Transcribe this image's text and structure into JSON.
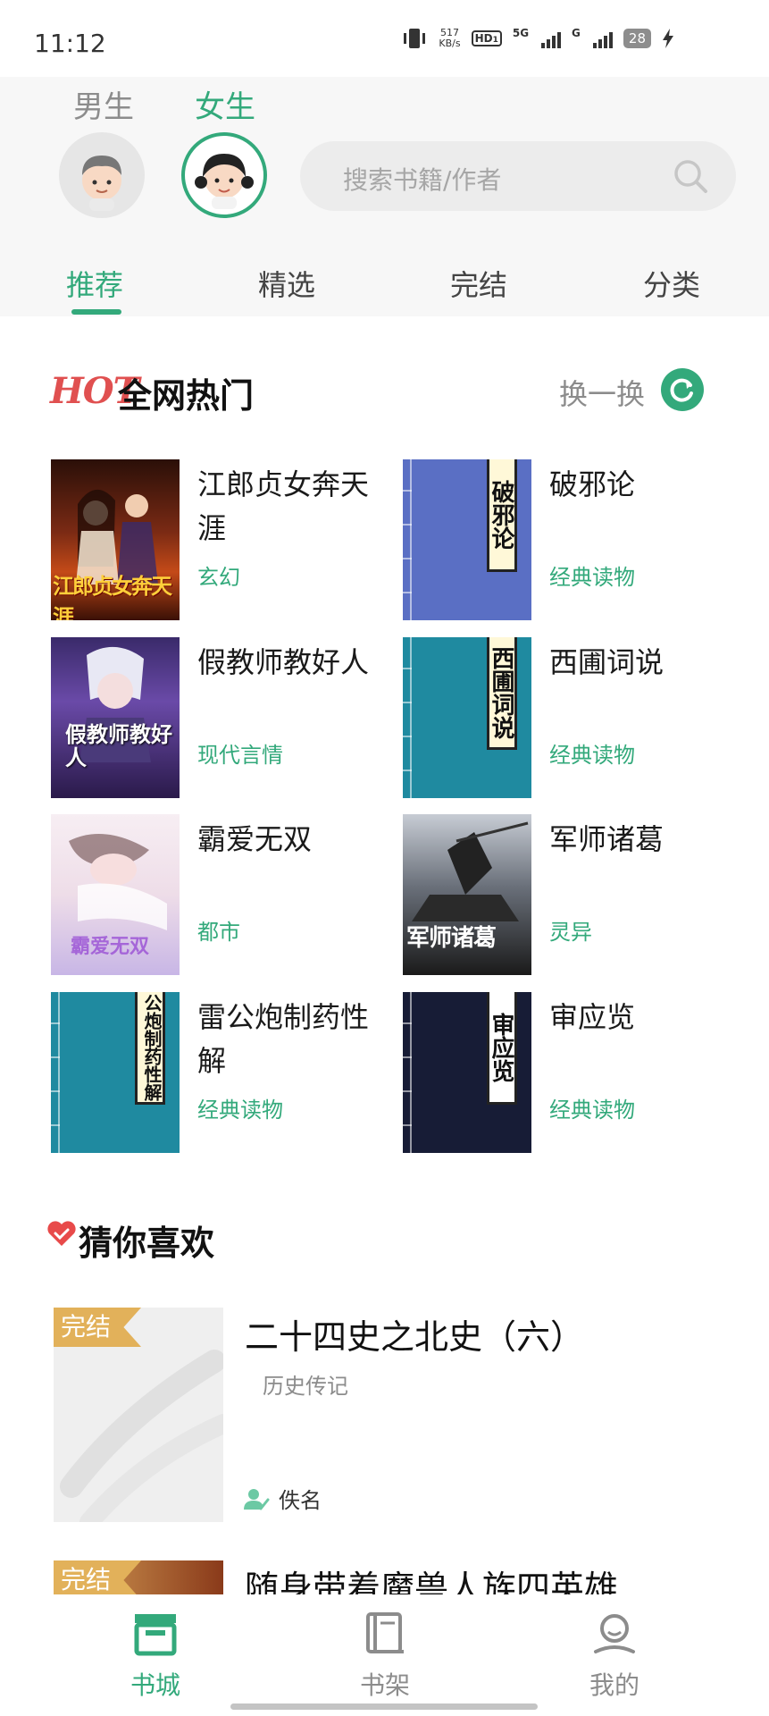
{
  "status_bar": {
    "time": "11:12",
    "net_speed_value": "517",
    "net_speed_unit": "KB/s",
    "hd": "HD",
    "hd_sub": "1",
    "net1": "5G",
    "net2": "G",
    "battery": "28"
  },
  "header": {
    "gender_male": "男生",
    "gender_female": "女生",
    "selected_gender": "女生",
    "search_placeholder": "搜索书籍/作者",
    "tabs": [
      "推荐",
      "精选",
      "完结",
      "分类"
    ],
    "active_tab": "推荐"
  },
  "hot": {
    "logo": "HOT",
    "title": "全网热门",
    "refresh": "换一换",
    "books": [
      {
        "title": "江郎贞女奔天涯",
        "genre": "玄幻",
        "cover_text": "江郎贞女奔天涯"
      },
      {
        "title": "破邪论",
        "genre": "经典读物",
        "cover_text": "破邪论"
      },
      {
        "title": "假教师教好人",
        "genre": "现代言情",
        "cover_text": "假教师教好人"
      },
      {
        "title": "西圃词说",
        "genre": "经典读物",
        "cover_text": "西圃词说"
      },
      {
        "title": "霸爱无双",
        "genre": "都市",
        "cover_text": "霸爱无双"
      },
      {
        "title": "军师诸葛",
        "genre": "灵异",
        "cover_text": "军师诸葛"
      },
      {
        "title": "雷公炮制药性解",
        "genre": "经典读物",
        "cover_text": "公炮制药性解"
      },
      {
        "title": "审应览",
        "genre": "经典读物",
        "cover_text": "审应览"
      }
    ]
  },
  "guess": {
    "title": "猜你喜欢",
    "items": [
      {
        "badge": "完结",
        "title": "二十四史之北史（六）",
        "genre": "历史传记",
        "author": "佚名"
      },
      {
        "badge": "完结",
        "title": "随身带着魔兽人族四英雄"
      }
    ]
  },
  "nav": {
    "items": [
      {
        "label": "书城",
        "icon": "store-icon"
      },
      {
        "label": "书架",
        "icon": "bookshelf-icon"
      },
      {
        "label": "我的",
        "icon": "profile-icon"
      }
    ],
    "active": "书城"
  },
  "colors": {
    "accent": "#33a97b",
    "hot_red": "#e05050",
    "badge": "#e2b15a"
  }
}
